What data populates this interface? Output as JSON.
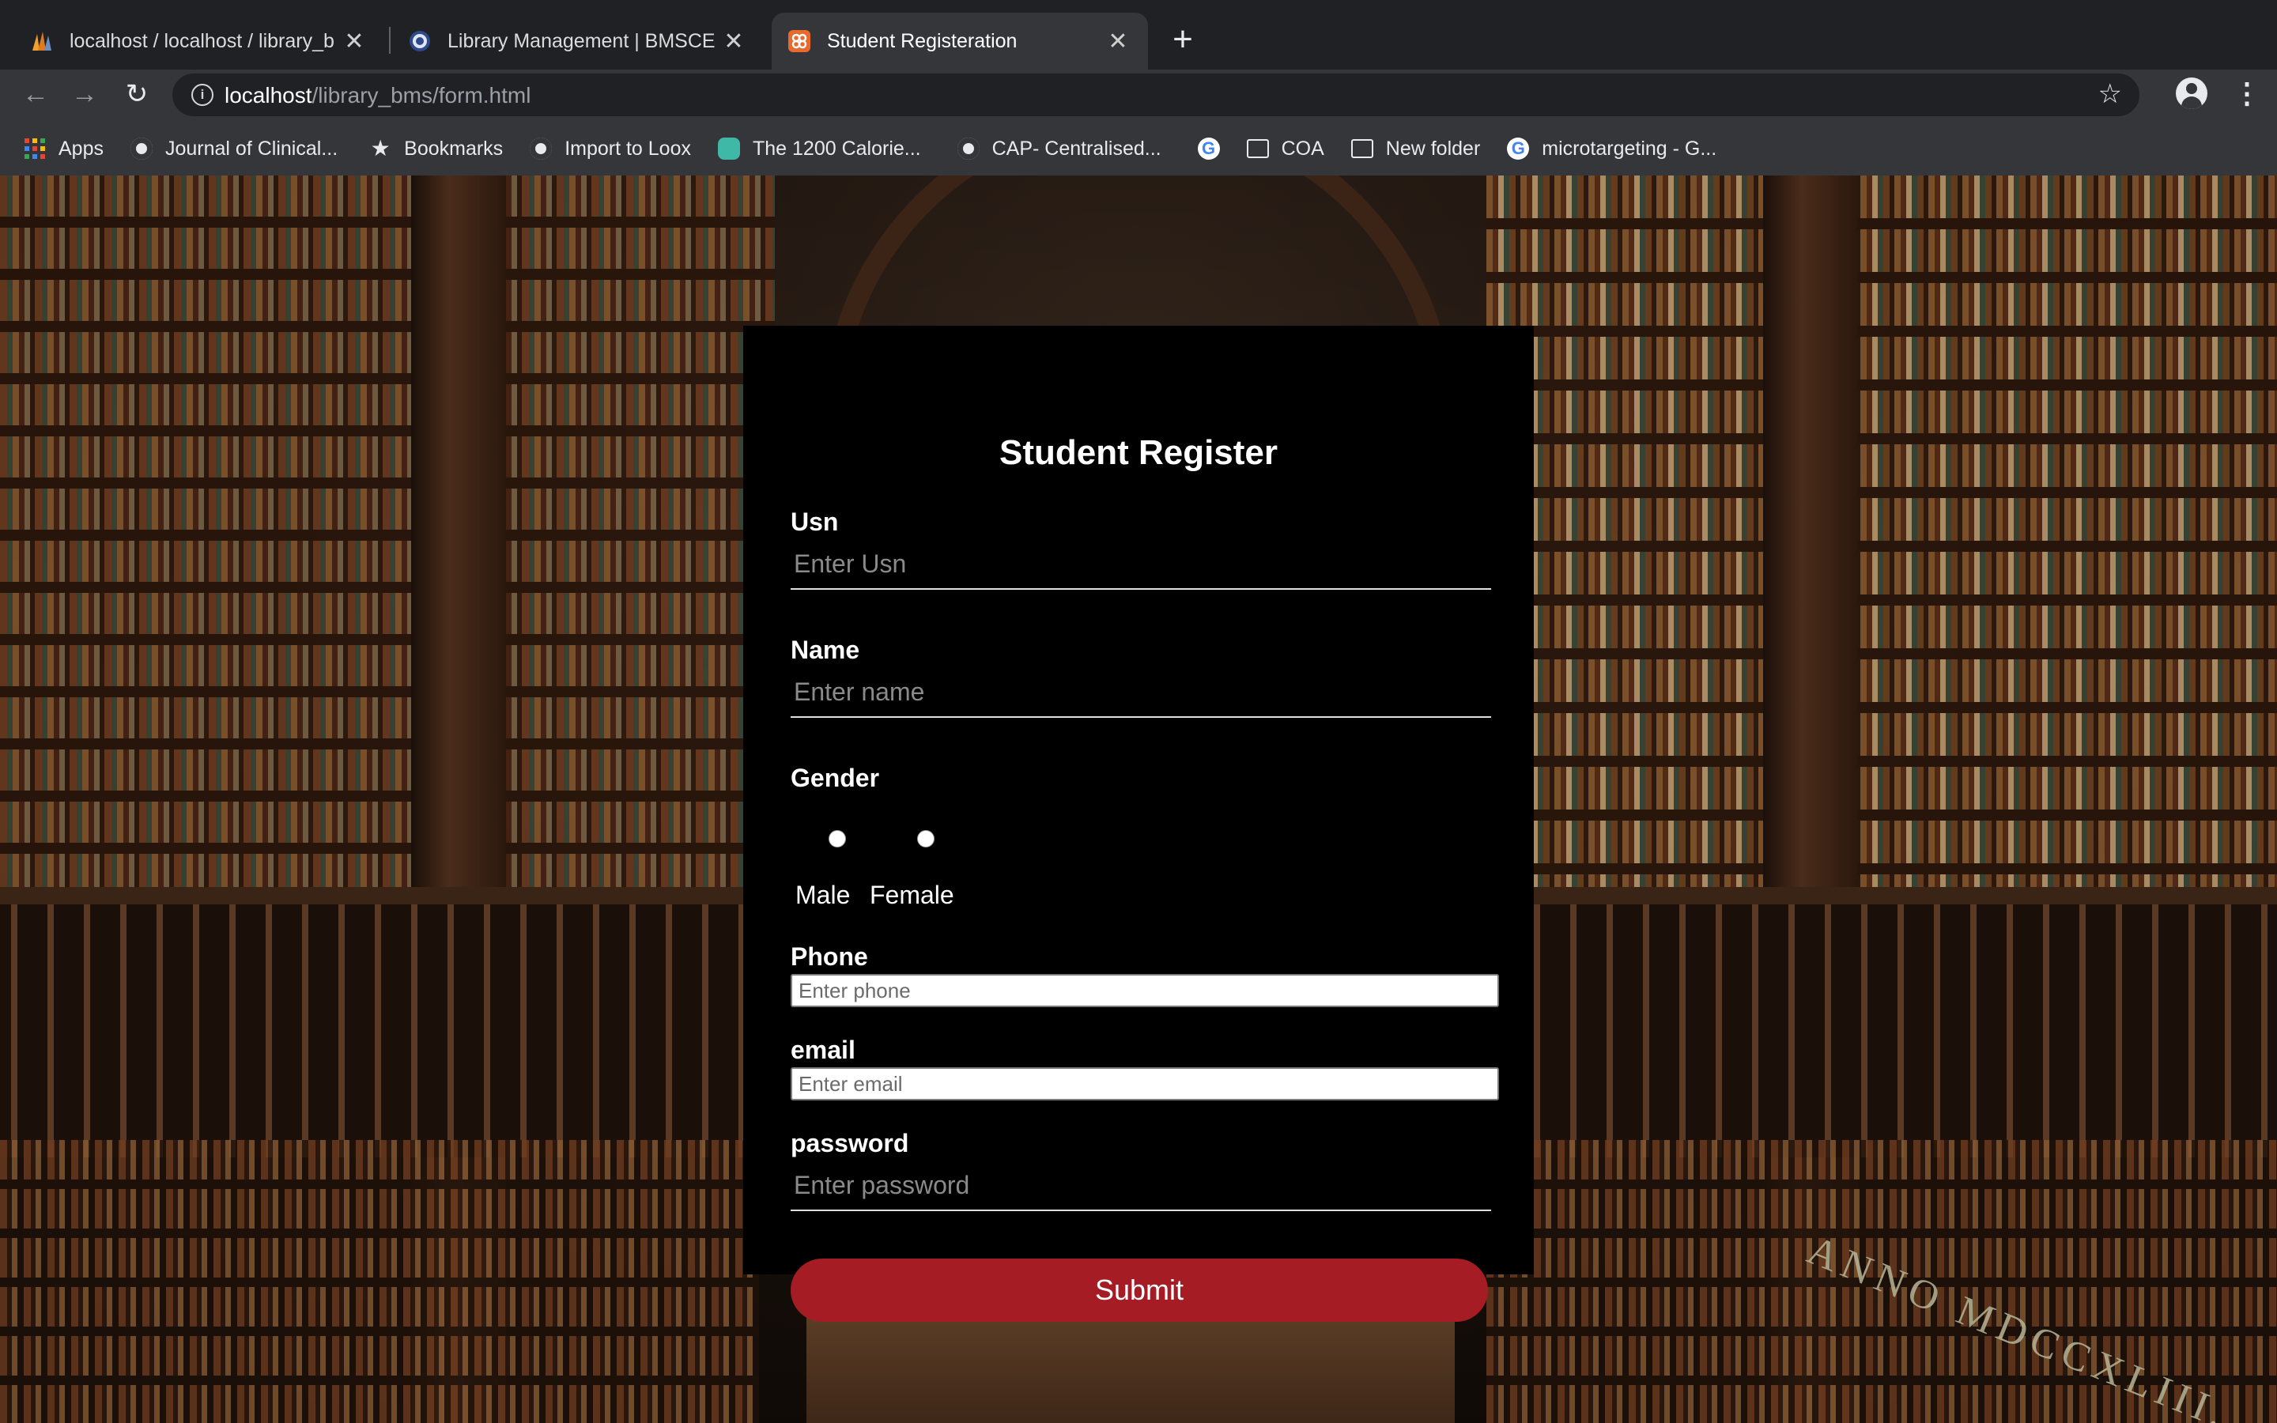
{
  "browser": {
    "tabs": [
      {
        "title": "localhost / localhost / library_b"
      },
      {
        "title": "Library Management | BMSCE"
      },
      {
        "title": "Student Registeration"
      }
    ],
    "url": {
      "host": "localhost",
      "path": "/library_bms/form.html"
    },
    "bookmarks": [
      {
        "label": "Apps"
      },
      {
        "label": "Journal of Clinical..."
      },
      {
        "label": "Bookmarks"
      },
      {
        "label": "Import to Loox"
      },
      {
        "label": "The 1200 Calorie..."
      },
      {
        "label": "CAP- Centralised..."
      },
      {
        "label": ""
      },
      {
        "label": "COA"
      },
      {
        "label": "New folder"
      },
      {
        "label": "microtargeting - G..."
      }
    ]
  },
  "page": {
    "background_text": "ANNO MDCCXLIII.",
    "form": {
      "title": "Student Register",
      "usn": {
        "label": "Usn",
        "placeholder": "Enter Usn"
      },
      "name": {
        "label": "Name",
        "placeholder": "Enter name"
      },
      "gender": {
        "label": "Gender",
        "options": [
          "Male",
          "Female"
        ]
      },
      "phone": {
        "label": "Phone",
        "placeholder": "Enter phone"
      },
      "email": {
        "label": "email",
        "placeholder": "Enter email"
      },
      "password": {
        "label": "password",
        "placeholder": "Enter password"
      },
      "submit_label": "Submit"
    }
  },
  "colors": {
    "submit": "#a51c24",
    "form_bg": "#000000",
    "chrome": "#35363a"
  }
}
